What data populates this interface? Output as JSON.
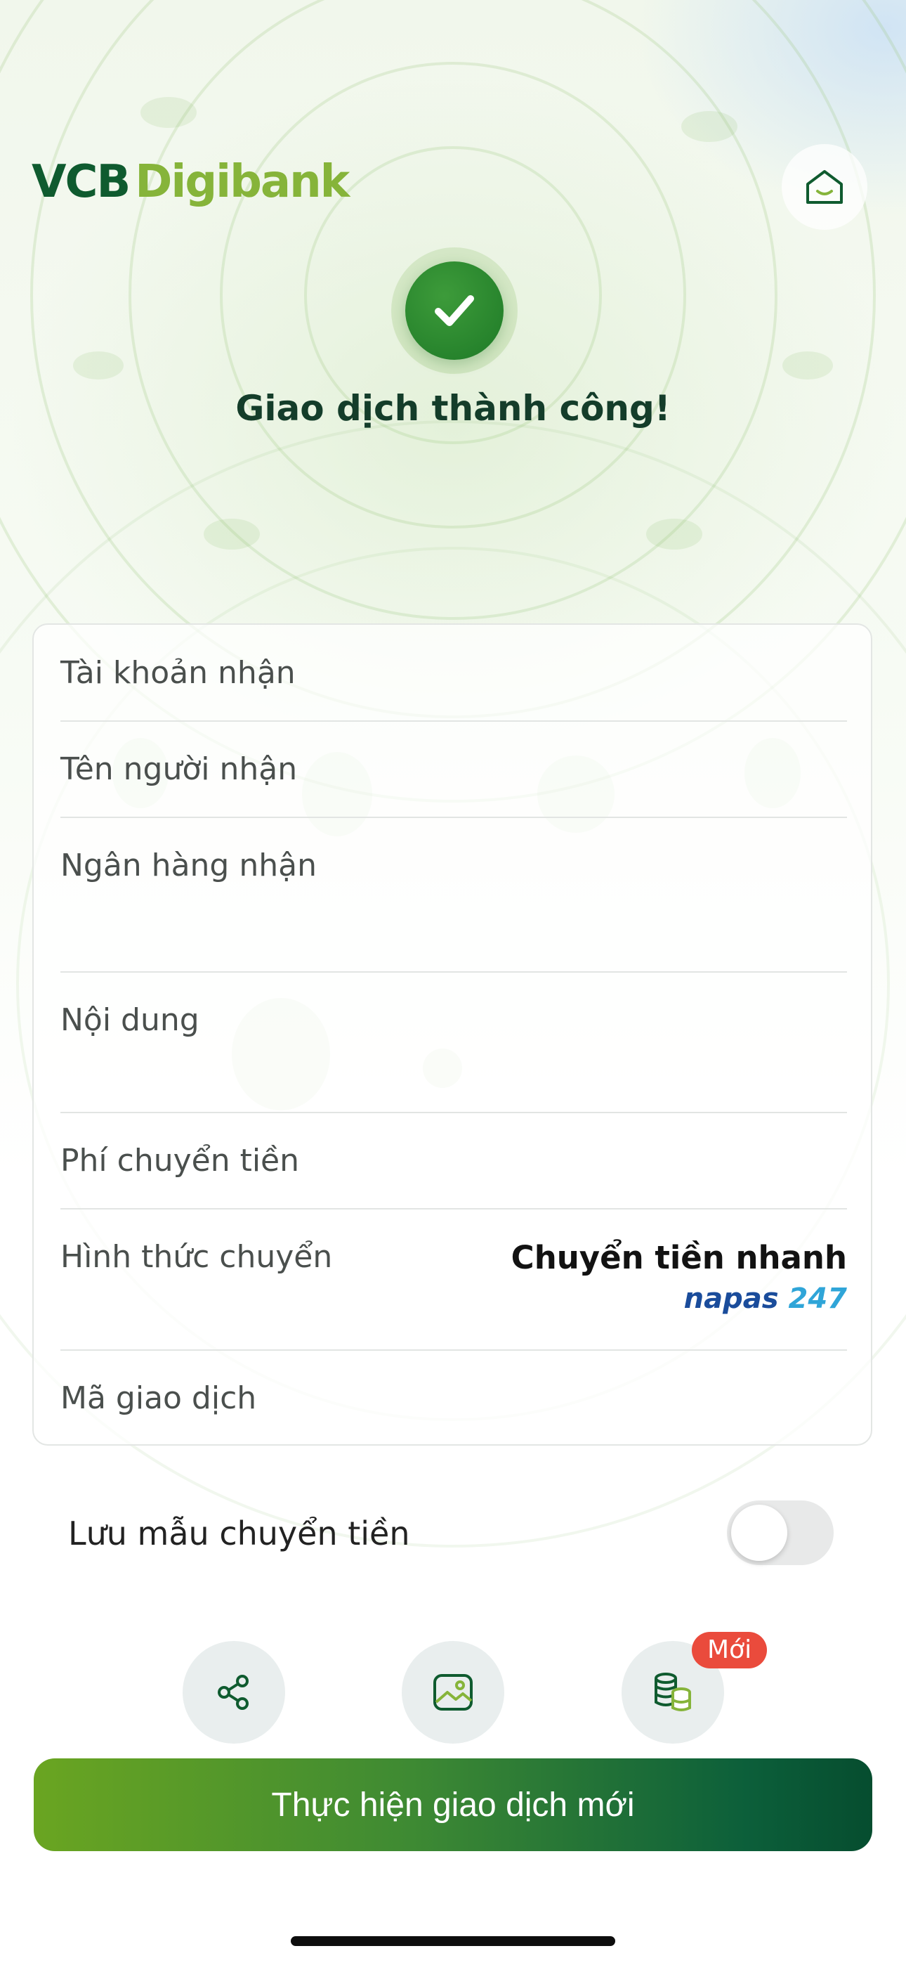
{
  "header": {
    "logo_part1": "VCB",
    "logo_part2": "Digibank"
  },
  "success": {
    "title": "Giao dịch thành công!"
  },
  "details": {
    "account_label": "Tài khoản nhận",
    "recipient_label": "Tên người nhận",
    "bank_label": "Ngân hàng nhận",
    "content_label": "Nội dung",
    "fee_label": "Phí chuyển tiền",
    "method_label": "Hình thức chuyển",
    "method_value": "Chuyển tiền nhanh",
    "napas_part1": "napas",
    "napas_part2": "247",
    "txn_label": "Mã giao dịch"
  },
  "save_template": {
    "label": "Lưu mẫu chuyển tiền",
    "enabled": false
  },
  "actions": {
    "new_badge": "Mới"
  },
  "main_button": {
    "label": "Thực hiện giao dịch mới"
  },
  "colors": {
    "brand_dark": "#0f5b2f",
    "brand_light": "#86b43a",
    "badge": "#ea4b3c"
  }
}
